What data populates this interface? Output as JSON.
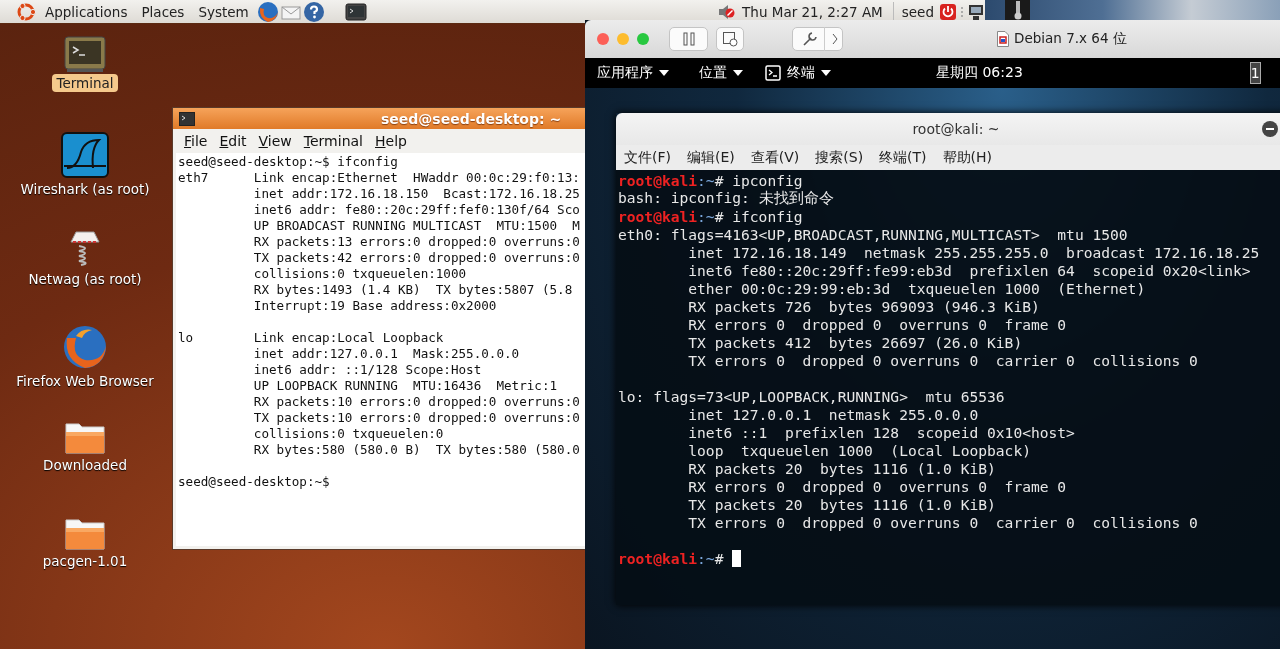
{
  "host_panel": {
    "menus": [
      "Applications",
      "Places",
      "System"
    ],
    "clock": "Thu Mar 21,  2:27 AM",
    "user": "seed"
  },
  "desktop_icons": [
    {
      "kind": "terminal",
      "label": "Terminal",
      "selected": true
    },
    {
      "kind": "wireshark",
      "label": "Wireshark (as root)",
      "selected": false
    },
    {
      "kind": "netwag",
      "label": "Netwag (as root)",
      "selected": false
    },
    {
      "kind": "firefox",
      "label": "Firefox Web Browser",
      "selected": false
    },
    {
      "kind": "folder",
      "label": "Downloaded",
      "selected": false
    },
    {
      "kind": "folder",
      "label": "pacgen-1.01",
      "selected": false
    }
  ],
  "host_terminal": {
    "title": "seed@seed-desktop: ~",
    "menus": [
      "File",
      "Edit",
      "View",
      "Terminal",
      "Help"
    ],
    "blocks": [
      [
        "seed@seed-desktop:~$ ifconfig",
        "eth7      Link encap:Ethernet  HWaddr 00:0c:29:f0:13:",
        "          inet addr:172.16.18.150  Bcast:172.16.18.25",
        "          inet6 addr: fe80::20c:29ff:fef0:130f/64 Sco",
        "          UP BROADCAST RUNNING MULTICAST  MTU:1500  M",
        "          RX packets:13 errors:0 dropped:0 overruns:0",
        "          TX packets:42 errors:0 dropped:0 overruns:0",
        "          collisions:0 txqueuelen:1000",
        "          RX bytes:1493 (1.4 KB)  TX bytes:5807 (5.8",
        "          Interrupt:19 Base address:0x2000"
      ],
      [
        "lo        Link encap:Local Loopback",
        "          inet addr:127.0.0.1  Mask:255.0.0.0",
        "          inet6 addr: ::1/128 Scope:Host",
        "          UP LOOPBACK RUNNING  MTU:16436  Metric:1",
        "          RX packets:10 errors:0 dropped:0 overruns:0",
        "          TX packets:10 errors:0 dropped:0 overruns:0",
        "          collisions:0 txqueuelen:0",
        "          RX bytes:580 (580.0 B)  TX bytes:580 (580.0"
      ],
      [
        "seed@seed-desktop:~$"
      ]
    ]
  },
  "vm_window": {
    "title": "Debian 7.x 64 位"
  },
  "guest_panel": {
    "menus": [
      "应用程序",
      "位置",
      "终端"
    ],
    "clock": "星期四 06:23",
    "workspace": "1"
  },
  "guest_terminal": {
    "title": "root@kali: ~",
    "menus": [
      "文件(F)",
      "编辑(E)",
      "查看(V)",
      "搜索(S)",
      "终端(T)",
      "帮助(H)"
    ],
    "blocks": [
      [
        {
          "kind": "prompt",
          "user": "root@kali",
          "path": ":~",
          "symbol": "#",
          "command": "ipconfig"
        },
        {
          "kind": "output",
          "text": "bash: ipconfig: 未找到命令"
        },
        {
          "kind": "prompt",
          "user": "root@kali",
          "path": ":~",
          "symbol": "#",
          "command": "ifconfig"
        },
        {
          "kind": "output",
          "text": "eth0: flags=4163<UP,BROADCAST,RUNNING,MULTICAST>  mtu 1500"
        },
        {
          "kind": "output",
          "text": "        inet 172.16.18.149  netmask 255.255.255.0  broadcast 172.16.18.25"
        },
        {
          "kind": "output",
          "text": "        inet6 fe80::20c:29ff:fe99:eb3d  prefixlen 64  scopeid 0x20<link>"
        },
        {
          "kind": "output",
          "text": "        ether 00:0c:29:99:eb:3d  txqueuelen 1000  (Ethernet)"
        },
        {
          "kind": "output",
          "text": "        RX packets 726  bytes 969093 (946.3 KiB)"
        },
        {
          "kind": "output",
          "text": "        RX errors 0  dropped 0  overruns 0  frame 0"
        },
        {
          "kind": "output",
          "text": "        TX packets 412  bytes 26697 (26.0 KiB)"
        },
        {
          "kind": "output",
          "text": "        TX errors 0  dropped 0 overruns 0  carrier 0  collisions 0"
        }
      ],
      [
        {
          "kind": "output",
          "text": "lo: flags=73<UP,LOOPBACK,RUNNING>  mtu 65536"
        },
        {
          "kind": "output",
          "text": "        inet 127.0.0.1  netmask 255.0.0.0"
        },
        {
          "kind": "output",
          "text": "        inet6 ::1  prefixlen 128  scopeid 0x10<host>"
        },
        {
          "kind": "output",
          "text": "        loop  txqueuelen 1000  (Local Loopback)"
        },
        {
          "kind": "output",
          "text": "        RX packets 20  bytes 1116 (1.0 KiB)"
        },
        {
          "kind": "output",
          "text": "        RX errors 0  dropped 0  overruns 0  frame 0"
        },
        {
          "kind": "output",
          "text": "        TX packets 20  bytes 1116 (1.0 KiB)"
        },
        {
          "kind": "output",
          "text": "        TX errors 0  dropped 0 overruns 0  carrier 0  collisions 0"
        }
      ],
      [
        {
          "kind": "prompt",
          "user": "root@kali",
          "path": ":~",
          "symbol": "#",
          "cursor": true
        }
      ]
    ]
  }
}
